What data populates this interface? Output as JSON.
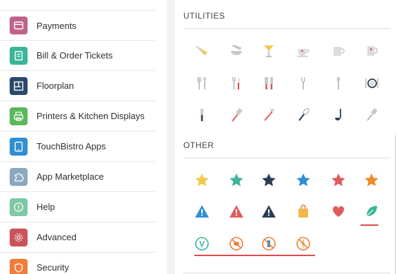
{
  "sidebar": {
    "items": [
      {
        "label": "Payments",
        "icon": "payments-icon",
        "color": "#c0638a"
      },
      {
        "label": "Bill & Order Tickets",
        "icon": "ticket-icon",
        "color": "#3bb59a"
      },
      {
        "label": "Floorplan",
        "icon": "floorplan-icon",
        "color": "#2a4a6b"
      },
      {
        "label": "Printers & Kitchen Displays",
        "icon": "printer-icon",
        "color": "#5cb85c"
      },
      {
        "label": "TouchBistro Apps",
        "icon": "tablet-icon",
        "color": "#2f8fd0"
      },
      {
        "label": "App Marketplace",
        "icon": "puzzle-icon",
        "color": "#8aa9bf"
      },
      {
        "label": "Help",
        "icon": "help-icon",
        "color": "#7dc9a6"
      },
      {
        "label": "Advanced",
        "icon": "gear-icon",
        "color": "#c9555a"
      },
      {
        "label": "Security",
        "icon": "shield-icon",
        "color": "#ee7f3a"
      }
    ]
  },
  "utilities": {
    "title": "UTILITIES",
    "icons": [
      "cheese-icon",
      "bowl-icon",
      "martini-icon",
      "teacup-icon",
      "mug-icon",
      "beer-mug-icon",
      "fork-spoon-icon",
      "fork-knife-icon",
      "cleaver-knife-icon",
      "fork-icon",
      "spoon-icon",
      "plate-setting-icon",
      "knife-icon",
      "spatula-icon",
      "carving-fork-icon",
      "whisk-icon",
      "ladle-icon",
      "slotted-spatula-icon"
    ]
  },
  "other": {
    "title": "OTHER",
    "icons": [
      {
        "name": "star-yellow-icon",
        "color": "#f5c94e"
      },
      {
        "name": "star-green-icon",
        "color": "#3bb59a"
      },
      {
        "name": "star-navy-icon",
        "color": "#2a3f55"
      },
      {
        "name": "star-blue-icon",
        "color": "#2f8fd0"
      },
      {
        "name": "star-red-icon",
        "color": "#e25b5b"
      },
      {
        "name": "star-orange-icon",
        "color": "#f08a24"
      },
      {
        "name": "warning-blue-icon",
        "color": "#2f8fd0"
      },
      {
        "name": "warning-red-icon",
        "color": "#e25b5b"
      },
      {
        "name": "warning-navy-icon",
        "color": "#2a3f55"
      },
      {
        "name": "shopping-bag-icon",
        "color": "#f2b64f"
      },
      {
        "name": "heart-icon",
        "color": "#e25b5b"
      },
      {
        "name": "leaf-icon",
        "color": "#3bb59a"
      },
      {
        "name": "vegetarian-icon",
        "color": "#3bb59a",
        "text": "V"
      },
      {
        "name": "no-nuts-icon",
        "color": "#ee7f3a"
      },
      {
        "name": "no-dairy-icon",
        "color": "#ee7f3a"
      },
      {
        "name": "no-gluten-icon",
        "color": "#ee7f3a"
      }
    ]
  },
  "colors": {
    "highlight_underline": "#e04848",
    "utility_icon_gray": "#b9b9b9",
    "utility_icon_accent": "#f5c94e",
    "utility_icon_red": "#d9534f"
  }
}
